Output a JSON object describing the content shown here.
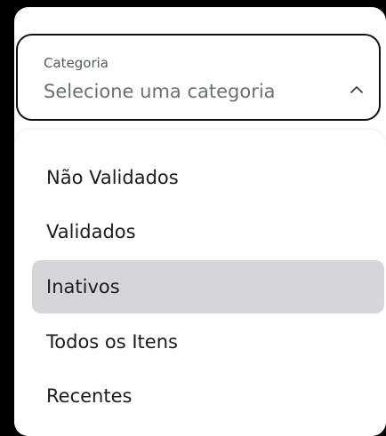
{
  "select": {
    "label": "Categoria",
    "placeholder": "Selecione uma categoria",
    "icon": "chevron-up-icon"
  },
  "options": [
    {
      "label": "Não Validados",
      "selected": false
    },
    {
      "label": "Validados",
      "selected": false
    },
    {
      "label": "Inativos",
      "selected": true
    },
    {
      "label": "Todos os Itens",
      "selected": false
    },
    {
      "label": "Recentes",
      "selected": false
    }
  ],
  "colors": {
    "background": "#000000",
    "panel": "#ffffff",
    "selected_item": "#d6d6da",
    "border": "#111111"
  }
}
